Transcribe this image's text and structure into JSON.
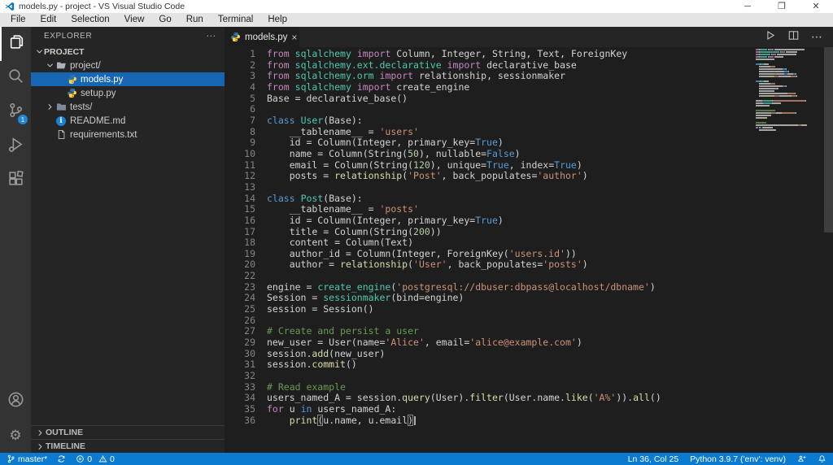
{
  "window": {
    "title": "models.py - project - VS Visual Studio Code",
    "controls": [
      {
        "name": "minimize-button"
      },
      {
        "name": "maximize-button"
      },
      {
        "name": "close-button"
      }
    ]
  },
  "menubar": [
    "File",
    "Edit",
    "Selection",
    "View",
    "Go",
    "Run",
    "Terminal",
    "Help"
  ],
  "activitybar": {
    "top": [
      {
        "name": "explorer",
        "icon": "files-icon",
        "active": true
      },
      {
        "name": "search",
        "icon": "search-icon",
        "active": false
      },
      {
        "name": "source-control",
        "icon": "source-control-icon",
        "active": false,
        "badge": "1"
      },
      {
        "name": "run-debug",
        "icon": "debug-icon",
        "active": false
      },
      {
        "name": "extensions",
        "icon": "extensions-icon",
        "active": false
      }
    ],
    "bottom": [
      {
        "name": "account",
        "icon": "account-icon"
      },
      {
        "name": "settings",
        "icon": "gear-icon"
      }
    ]
  },
  "sidebar": {
    "header": "EXPLORER",
    "header_more": "⋯",
    "tree": [
      {
        "label": "PROJECT",
        "section": true,
        "chevron": "down",
        "indent": 0,
        "icon": null,
        "selected": false
      },
      {
        "label": "project/",
        "section": false,
        "chevron": "down",
        "indent": 1,
        "icon": "folder-open-icon",
        "selected": false
      },
      {
        "label": "models.py",
        "section": false,
        "chevron": null,
        "indent": 2,
        "icon": "python-icon",
        "selected": true
      },
      {
        "label": "setup.py",
        "section": false,
        "chevron": null,
        "indent": 2,
        "icon": "python-icon",
        "selected": false
      },
      {
        "label": "tests/",
        "section": false,
        "chevron": "right",
        "indent": 1,
        "icon": "folder-closed-icon",
        "selected": false
      },
      {
        "label": "README.md",
        "section": false,
        "chevron": null,
        "indent": 1,
        "icon": "info-icon",
        "selected": false
      },
      {
        "label": "requirements.txt",
        "section": false,
        "chevron": null,
        "indent": 1,
        "icon": "file-icon",
        "selected": false
      }
    ],
    "bottom_panels": [
      {
        "label": "OUTLINE",
        "chevron": "right"
      },
      {
        "label": "TIMELINE",
        "chevron": "right"
      }
    ]
  },
  "editor": {
    "tab": {
      "label": "models.py",
      "icon": "python-icon",
      "close_glyph": "×"
    },
    "actions": [
      {
        "name": "run-button",
        "icon": "run-icon"
      },
      {
        "name": "split-editor-button",
        "icon": "split-editor-icon"
      },
      {
        "name": "more-actions-button",
        "icon": "more-icon"
      }
    ],
    "token_colors": {
      "k": "#C586C0",
      "b": "#569CD6",
      "t": "#4EC9B0",
      "f": "#DCDCAA",
      "s": "#CE9178",
      "c": "#6A9955",
      "n": "#B5CEA8",
      "d": "#D4D4D4",
      "bracket": "#D4D4D4"
    },
    "lines": [
      {
        "num": "1",
        "segs": [
          [
            "k",
            "from"
          ],
          [
            "d",
            " "
          ],
          [
            "t",
            "sqlalchemy"
          ],
          [
            "d",
            " "
          ],
          [
            "k",
            "import"
          ],
          [
            "d",
            " Column, Integer, String, Text, ForeignKey"
          ]
        ]
      },
      {
        "num": "2",
        "segs": [
          [
            "k",
            "from"
          ],
          [
            "d",
            " "
          ],
          [
            "t",
            "sqlalchemy.ext.declarative"
          ],
          [
            "d",
            " "
          ],
          [
            "k",
            "import"
          ],
          [
            "d",
            " declarative_base"
          ]
        ]
      },
      {
        "num": "3",
        "segs": [
          [
            "k",
            "from"
          ],
          [
            "d",
            " "
          ],
          [
            "t",
            "sqlalchemy.orm"
          ],
          [
            "d",
            " "
          ],
          [
            "k",
            "import"
          ],
          [
            "d",
            " relationship, sessionmaker"
          ]
        ]
      },
      {
        "num": "4",
        "segs": [
          [
            "k",
            "from"
          ],
          [
            "d",
            " "
          ],
          [
            "t",
            "sqlalchemy"
          ],
          [
            "d",
            " "
          ],
          [
            "k",
            "import"
          ],
          [
            "d",
            " create_engine"
          ]
        ]
      },
      {
        "num": "5",
        "segs": [
          [
            "d",
            "Base = declarative_base()"
          ]
        ]
      },
      {
        "num": "6",
        "segs": []
      },
      {
        "num": "7",
        "segs": [
          [
            "b",
            "class"
          ],
          [
            "d",
            " "
          ],
          [
            "t",
            "User"
          ],
          [
            "d",
            "(Base):"
          ]
        ]
      },
      {
        "num": "8",
        "segs": [
          [
            "d",
            "    __tablename__ = "
          ],
          [
            "s",
            "'users'"
          ]
        ]
      },
      {
        "num": "9",
        "segs": [
          [
            "d",
            "    id = Column(Integer, primary_key="
          ],
          [
            "b",
            "True"
          ],
          [
            "d",
            ")"
          ]
        ]
      },
      {
        "num": "10",
        "segs": [
          [
            "d",
            "    name = Column(String("
          ],
          [
            "n",
            "50"
          ],
          [
            "d",
            "), nullable="
          ],
          [
            "b",
            "False"
          ],
          [
            "d",
            ")"
          ]
        ]
      },
      {
        "num": "11",
        "segs": [
          [
            "d",
            "    email = Column(String("
          ],
          [
            "n",
            "120"
          ],
          [
            "d",
            "), unique="
          ],
          [
            "b",
            "True"
          ],
          [
            "d",
            ", index="
          ],
          [
            "b",
            "True"
          ],
          [
            "d",
            ")"
          ]
        ]
      },
      {
        "num": "12",
        "segs": [
          [
            "d",
            "    posts = "
          ],
          [
            "f",
            "relationship"
          ],
          [
            "d",
            "("
          ],
          [
            "s",
            "'Post'"
          ],
          [
            "d",
            ", back_populates="
          ],
          [
            "s",
            "'author'"
          ],
          [
            "d",
            ")"
          ]
        ]
      },
      {
        "num": "13",
        "segs": []
      },
      {
        "num": "14",
        "segs": [
          [
            "b",
            "class"
          ],
          [
            "d",
            " "
          ],
          [
            "t",
            "Post"
          ],
          [
            "d",
            "(Base):"
          ]
        ]
      },
      {
        "num": "15",
        "segs": [
          [
            "d",
            "    __tablename__ = "
          ],
          [
            "s",
            "'posts'"
          ]
        ]
      },
      {
        "num": "16",
        "segs": [
          [
            "d",
            "    id = Column(Integer, primary_key="
          ],
          [
            "b",
            "True"
          ],
          [
            "d",
            ")"
          ]
        ]
      },
      {
        "num": "17",
        "segs": [
          [
            "d",
            "    title = Column(String("
          ],
          [
            "n",
            "200"
          ],
          [
            "d",
            "))"
          ]
        ]
      },
      {
        "num": "18",
        "segs": [
          [
            "d",
            "    content = Column(Text)"
          ]
        ]
      },
      {
        "num": "19",
        "segs": [
          [
            "d",
            "    author_id = Column(Integer, ForeignKey("
          ],
          [
            "s",
            "'users.id'"
          ],
          [
            "d",
            "))"
          ]
        ]
      },
      {
        "num": "20",
        "segs": [
          [
            "d",
            "    author = "
          ],
          [
            "f",
            "relationship"
          ],
          [
            "d",
            "("
          ],
          [
            "s",
            "'User'"
          ],
          [
            "d",
            ", back_populates="
          ],
          [
            "s",
            "'posts'"
          ],
          [
            "d",
            ")"
          ]
        ]
      },
      {
        "num": "22",
        "segs": []
      },
      {
        "num": "23",
        "segs": [
          [
            "d",
            "engine = "
          ],
          [
            "t",
            "create_engine"
          ],
          [
            "d",
            "("
          ],
          [
            "s",
            "'postgresql://dbuser:dbpass@localhost/dbname'"
          ],
          [
            "d",
            ")"
          ]
        ]
      },
      {
        "num": "24",
        "segs": [
          [
            "d",
            "Session = "
          ],
          [
            "t",
            "sessionmaker"
          ],
          [
            "d",
            "(bind=engine)"
          ]
        ]
      },
      {
        "num": "25",
        "segs": [
          [
            "d",
            "session = Session()"
          ]
        ]
      },
      {
        "num": "26",
        "segs": []
      },
      {
        "num": "27",
        "segs": [
          [
            "c",
            "# Create and persist a user"
          ]
        ]
      },
      {
        "num": "29",
        "segs": [
          [
            "d",
            "new_user = User(name="
          ],
          [
            "s",
            "'Alice'"
          ],
          [
            "d",
            ", email="
          ],
          [
            "s",
            "'alice@example.com'"
          ],
          [
            "d",
            ")"
          ]
        ]
      },
      {
        "num": "30",
        "segs": [
          [
            "d",
            "session."
          ],
          [
            "f",
            "add"
          ],
          [
            "d",
            "(new_user)"
          ]
        ]
      },
      {
        "num": "31",
        "segs": [
          [
            "d",
            "session."
          ],
          [
            "f",
            "commit"
          ],
          [
            "d",
            "()"
          ]
        ]
      },
      {
        "num": "32",
        "segs": []
      },
      {
        "num": "33",
        "segs": [
          [
            "c",
            "# Read example"
          ]
        ]
      },
      {
        "num": "34",
        "segs": [
          [
            "d",
            "users_named_A = session."
          ],
          [
            "f",
            "query"
          ],
          [
            "d",
            "(User)."
          ],
          [
            "f",
            "filter"
          ],
          [
            "d",
            "(User.name."
          ],
          [
            "f",
            "like"
          ],
          [
            "d",
            "("
          ],
          [
            "s",
            "'A%'"
          ],
          [
            "d",
            "))."
          ],
          [
            "f",
            "all"
          ],
          [
            "d",
            "()"
          ]
        ]
      },
      {
        "num": "35",
        "segs": [
          [
            "k",
            "for"
          ],
          [
            "d",
            " u "
          ],
          [
            "b",
            "in"
          ],
          [
            "d",
            " users_named_A:"
          ]
        ]
      },
      {
        "num": "36",
        "segs": [
          [
            "d",
            "    "
          ],
          [
            "f",
            "print"
          ],
          [
            "bracket",
            "("
          ],
          [
            "d",
            "u.name, u.email"
          ],
          [
            "bracket",
            ")"
          ],
          [
            "cursor",
            ""
          ]
        ]
      }
    ]
  },
  "statusbar": {
    "branch_label": "master*",
    "errors": "0",
    "warnings": "0",
    "cursor_position": "Ln 36, Col 25",
    "interpreter": "Python 3.9.7 ('env': venv)"
  }
}
